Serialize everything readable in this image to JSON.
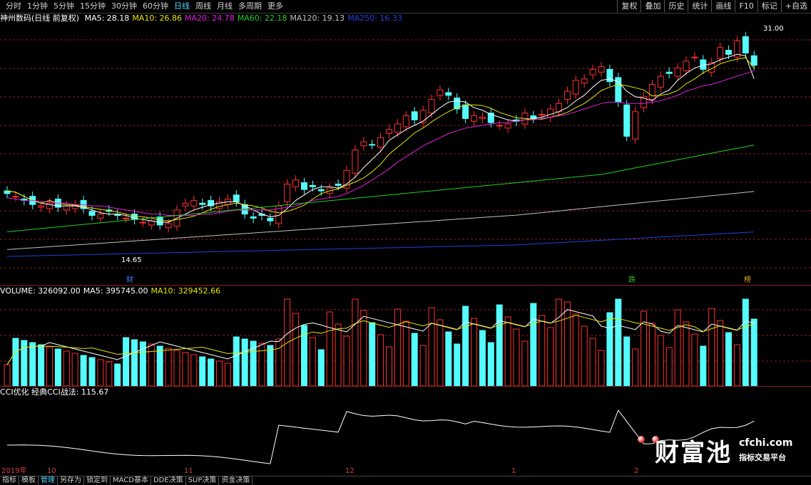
{
  "period_tabs": [
    "分时",
    "1分钟",
    "5分钟",
    "15分钟",
    "30分钟",
    "60分钟",
    "日线",
    "周线",
    "月线",
    "多周期",
    "更多"
  ],
  "active_period": "日线",
  "tool_buttons": [
    "复权",
    "叠加",
    "历史",
    "统计",
    "画线",
    "F10",
    "标记",
    "+自选"
  ],
  "price_panel": {
    "title": "神州数码(日线 前复权)",
    "ma": [
      {
        "label": "MA5: 28.18",
        "color": "#ffffff"
      },
      {
        "label": "MA10: 26.86",
        "color": "#e6e600"
      },
      {
        "label": "MA20: 24.78",
        "color": "#e020e0"
      },
      {
        "label": "MA60: 22.18",
        "color": "#20d020"
      },
      {
        "label": "MA120: 19.13",
        "color": "#c0c0c0"
      },
      {
        "label": "MA250: 16.33",
        "color": "#2040e0"
      }
    ],
    "high_label": "31.00",
    "low_label": "14.65",
    "markers": [
      {
        "text": "财",
        "color": "#4a7cff"
      },
      {
        "text": "跌",
        "color": "#30c030"
      },
      {
        "text": "榜",
        "color": "#e0a020"
      }
    ]
  },
  "volume_panel": {
    "labels": [
      {
        "text": "VOLUME: 326092.00",
        "color": "#ffffff"
      },
      {
        "text": "MA5: 395745.00",
        "color": "#ffffff"
      },
      {
        "text": "MA10: 329452.66",
        "color": "#e6e600"
      }
    ]
  },
  "cci_panel": {
    "label": "CCI优化 经典CCI战法: 115.67"
  },
  "x_axis": [
    "2019年",
    "10",
    "11",
    "12",
    "1",
    "2"
  ],
  "bottom_tabs": [
    "指标",
    "模板",
    "管理",
    "另存为",
    "锁定到",
    "MACD基本",
    "DDE决策",
    "SUP决策",
    "资金决策"
  ],
  "active_bottom_tab": "管理",
  "watermark": {
    "title": "财富池",
    "site": "cfchi.com",
    "subtitle": "指标交易平台"
  },
  "colors": {
    "up": "#ff3030",
    "down": "#54fcfc",
    "grid": "#8b1e1e"
  },
  "chart_data": {
    "type": "line",
    "candles_close": [
      19.8,
      19.6,
      19.3,
      19.0,
      18.9,
      19.1,
      18.8,
      18.9,
      19.0,
      18.7,
      18.2,
      18.3,
      18.5,
      18.2,
      18.0,
      17.9,
      17.7,
      17.8,
      17.5,
      17.6,
      18.6,
      19.1,
      19.3,
      19.0,
      18.9,
      19.2,
      19.4,
      19.2,
      18.3,
      18.0,
      18.2,
      17.8,
      18.9,
      20.5,
      20.8,
      20.1,
      20.3,
      20.0,
      20.2,
      20.4,
      21.5,
      23.0,
      23.6,
      23.4,
      23.9,
      24.5,
      24.9,
      25.5,
      25.2,
      25.9,
      26.7,
      27.4,
      27.0,
      26.0,
      25.3,
      25.5,
      25.4,
      25.0,
      24.8,
      24.9,
      25.1,
      25.7,
      25.3,
      25.6,
      26.0,
      26.4,
      27.3,
      28.1,
      28.2,
      28.9,
      29.1,
      28.0,
      26.5,
      24.0,
      25.8,
      26.9,
      27.8,
      28.4,
      28.6,
      29.0,
      29.5,
      29.8,
      28.9,
      29.4,
      30.5,
      30.0,
      31.0,
      30.1,
      29.2
    ],
    "ma5": [
      20.0,
      19.9,
      19.6,
      19.3,
      19.1,
      19.0,
      18.9,
      18.9,
      18.9,
      18.8,
      18.6,
      18.4,
      18.3,
      18.3,
      18.2,
      18.0,
      17.9,
      17.8,
      17.7,
      17.7,
      18.0,
      18.3,
      18.6,
      18.8,
      19.0,
      19.1,
      19.2,
      19.2,
      18.9,
      18.6,
      18.3,
      18.1,
      18.2,
      18.7,
      19.3,
      19.7,
      20.1,
      20.3,
      20.3,
      20.2,
      20.5,
      21.0,
      21.7,
      22.3,
      22.9,
      23.7,
      24.1,
      24.5,
      24.8,
      25.1,
      25.6,
      26.1,
      26.5,
      26.6,
      26.5,
      26.1,
      25.9,
      25.6,
      25.4,
      25.2,
      25.1,
      25.2,
      25.3,
      25.4,
      25.6,
      25.8,
      26.1,
      26.6,
      27.0,
      27.6,
      28.1,
      28.2,
      28.0,
      27.3,
      26.9,
      26.8,
      26.6,
      27.1,
      27.4,
      28.1,
      28.6,
      29.0,
      29.2,
      29.3,
      29.6,
      29.8,
      30.0,
      29.9,
      28.2
    ],
    "ma20": [
      19.5,
      19.4,
      19.3,
      19.3,
      19.2,
      19.2,
      19.1,
      19.1,
      19.0,
      19.0,
      18.9,
      18.9,
      18.8,
      18.7,
      18.6,
      18.5,
      18.4,
      18.3,
      18.3,
      18.2,
      18.2,
      18.2,
      18.2,
      18.3,
      18.3,
      18.4,
      18.5,
      18.6,
      18.6,
      18.6,
      18.6,
      18.6,
      18.7,
      18.8,
      18.9,
      19.1,
      19.3,
      19.4,
      19.5,
      19.6,
      19.8,
      20.1,
      20.4,
      20.8,
      21.2,
      21.6,
      22.1,
      22.5,
      22.9,
      23.3,
      23.6,
      23.9,
      24.2,
      24.4,
      24.6,
      24.7,
      24.8,
      24.9,
      25.0,
      25.0,
      25.1,
      25.2,
      25.2,
      25.3,
      25.4,
      25.5,
      25.6,
      25.8,
      26.0,
      26.2,
      26.4,
      26.5,
      26.5,
      26.4,
      26.4,
      26.4,
      26.5,
      26.6,
      26.8,
      27.0,
      27.3,
      27.5,
      27.7,
      27.8,
      28.0,
      28.2,
      28.4,
      28.6,
      28.8
    ]
  }
}
